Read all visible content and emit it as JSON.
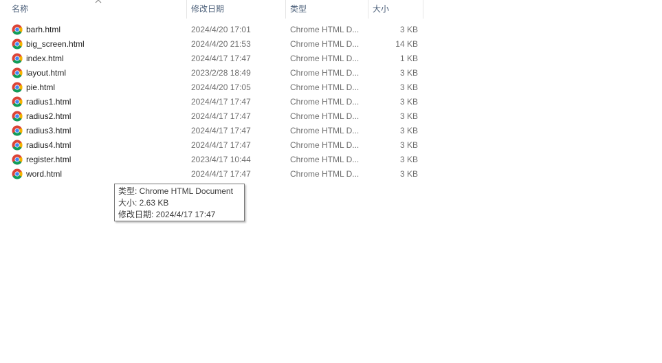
{
  "columns": {
    "name": "名称",
    "date": "修改日期",
    "type": "类型",
    "size": "大小"
  },
  "files": [
    {
      "name": "barh.html",
      "date": "2024/4/20 17:01",
      "type": "Chrome HTML D...",
      "size": "3 KB"
    },
    {
      "name": "big_screen.html",
      "date": "2024/4/20 21:53",
      "type": "Chrome HTML D...",
      "size": "14 KB"
    },
    {
      "name": "index.html",
      "date": "2024/4/17 17:47",
      "type": "Chrome HTML D...",
      "size": "1 KB"
    },
    {
      "name": "layout.html",
      "date": "2023/2/28 18:49",
      "type": "Chrome HTML D...",
      "size": "3 KB"
    },
    {
      "name": "pie.html",
      "date": "2024/4/20 17:05",
      "type": "Chrome HTML D...",
      "size": "3 KB"
    },
    {
      "name": "radius1.html",
      "date": "2024/4/17 17:47",
      "type": "Chrome HTML D...",
      "size": "3 KB"
    },
    {
      "name": "radius2.html",
      "date": "2024/4/17 17:47",
      "type": "Chrome HTML D...",
      "size": "3 KB"
    },
    {
      "name": "radius3.html",
      "date": "2024/4/17 17:47",
      "type": "Chrome HTML D...",
      "size": "3 KB"
    },
    {
      "name": "radius4.html",
      "date": "2024/4/17 17:47",
      "type": "Chrome HTML D...",
      "size": "3 KB"
    },
    {
      "name": "register.html",
      "date": "2023/4/17 10:44",
      "type": "Chrome HTML D...",
      "size": "3 KB"
    },
    {
      "name": "word.html",
      "date": "2024/4/17 17:47",
      "type": "Chrome HTML D...",
      "size": "3 KB"
    }
  ],
  "file_icon": "chrome-icon",
  "tooltip": {
    "type_line": "类型: Chrome HTML Document",
    "size_line": "大小: 2.63 KB",
    "date_line": "修改日期: 2024/4/17 17:47"
  },
  "colors": {
    "header_text": "#4c607a",
    "secondary_text": "#6d6d6d",
    "chrome_red": "#db4437",
    "chrome_yellow": "#f4b400",
    "chrome_green": "#0f9d58",
    "chrome_blue": "#4285f4"
  }
}
